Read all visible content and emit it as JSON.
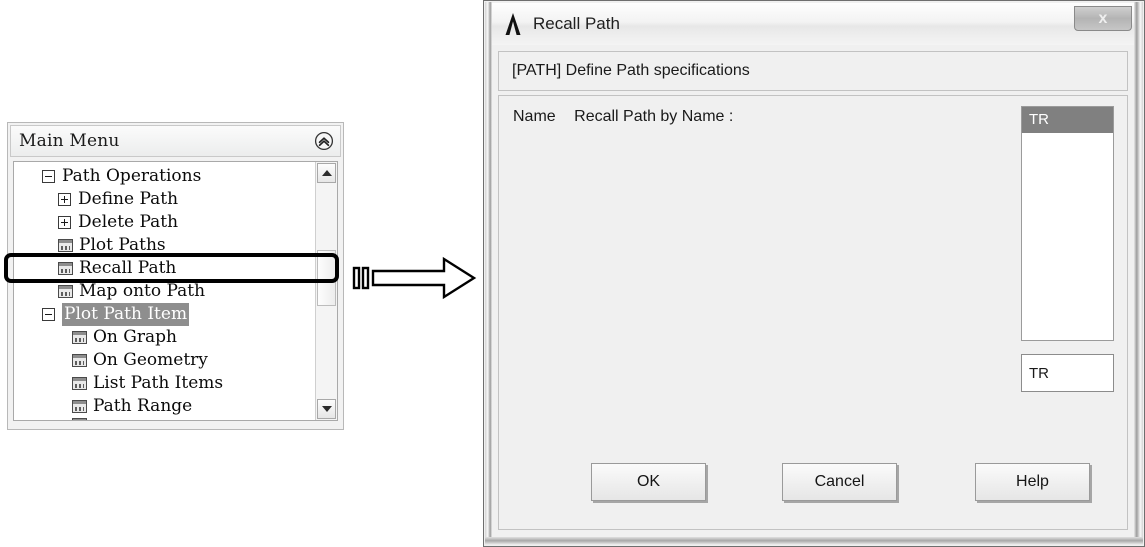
{
  "main_menu": {
    "title": "Main Menu",
    "collapse_icon": "chevron-double-up-circle-icon",
    "tree": [
      {
        "label": "Path Operations",
        "level": 0,
        "type": "branch",
        "expander": "minus",
        "state": "normal"
      },
      {
        "label": "Define Path",
        "level": 1,
        "type": "branch",
        "expander": "plus",
        "state": "normal"
      },
      {
        "label": "Delete Path",
        "level": 1,
        "type": "branch",
        "expander": "plus",
        "state": "normal"
      },
      {
        "label": "Plot Paths",
        "level": 1,
        "type": "leaf",
        "icon": "dialog-icon",
        "state": "normal"
      },
      {
        "label": "Recall Path",
        "level": 1,
        "type": "leaf",
        "icon": "dialog-icon",
        "state": "annotated"
      },
      {
        "label": "Map onto Path",
        "level": 1,
        "type": "leaf",
        "icon": "dialog-icon",
        "state": "normal"
      },
      {
        "label": "Plot Path Item",
        "level": 0,
        "type": "branch",
        "expander": "minus",
        "state": "highlighted"
      },
      {
        "label": "On Graph",
        "level": 2,
        "type": "leaf",
        "icon": "dialog-icon",
        "state": "normal"
      },
      {
        "label": "On Geometry",
        "level": 2,
        "type": "leaf",
        "icon": "dialog-icon",
        "state": "normal"
      },
      {
        "label": "List Path Items",
        "level": 2,
        "type": "leaf",
        "icon": "dialog-icon",
        "state": "normal"
      },
      {
        "label": "Path Range",
        "level": 2,
        "type": "leaf",
        "icon": "dialog-icon",
        "state": "normal"
      }
    ],
    "scrollbar": {
      "up_icon": "triangle-up-icon",
      "down_icon": "triangle-down-icon"
    }
  },
  "arrow": {
    "name": "flow-arrow",
    "direction": "right"
  },
  "dialog": {
    "logo": "ansys-a-logo",
    "title": "Recall Path",
    "close_label": "x",
    "prompt": "[PATH]  Define Path specifications",
    "name_label": "Name",
    "name_description": "Recall Path by Name :",
    "list_options": [
      "TR"
    ],
    "list_selected": "TR",
    "name_value": "TR",
    "buttons": {
      "ok": "OK",
      "cancel": "Cancel",
      "help": "Help"
    }
  },
  "colors": {
    "dialog_bg": "#f0f0f0",
    "selection_gray": "#808080",
    "tree_highlight": "#8e8e8e",
    "annotation_black": "#000000"
  }
}
